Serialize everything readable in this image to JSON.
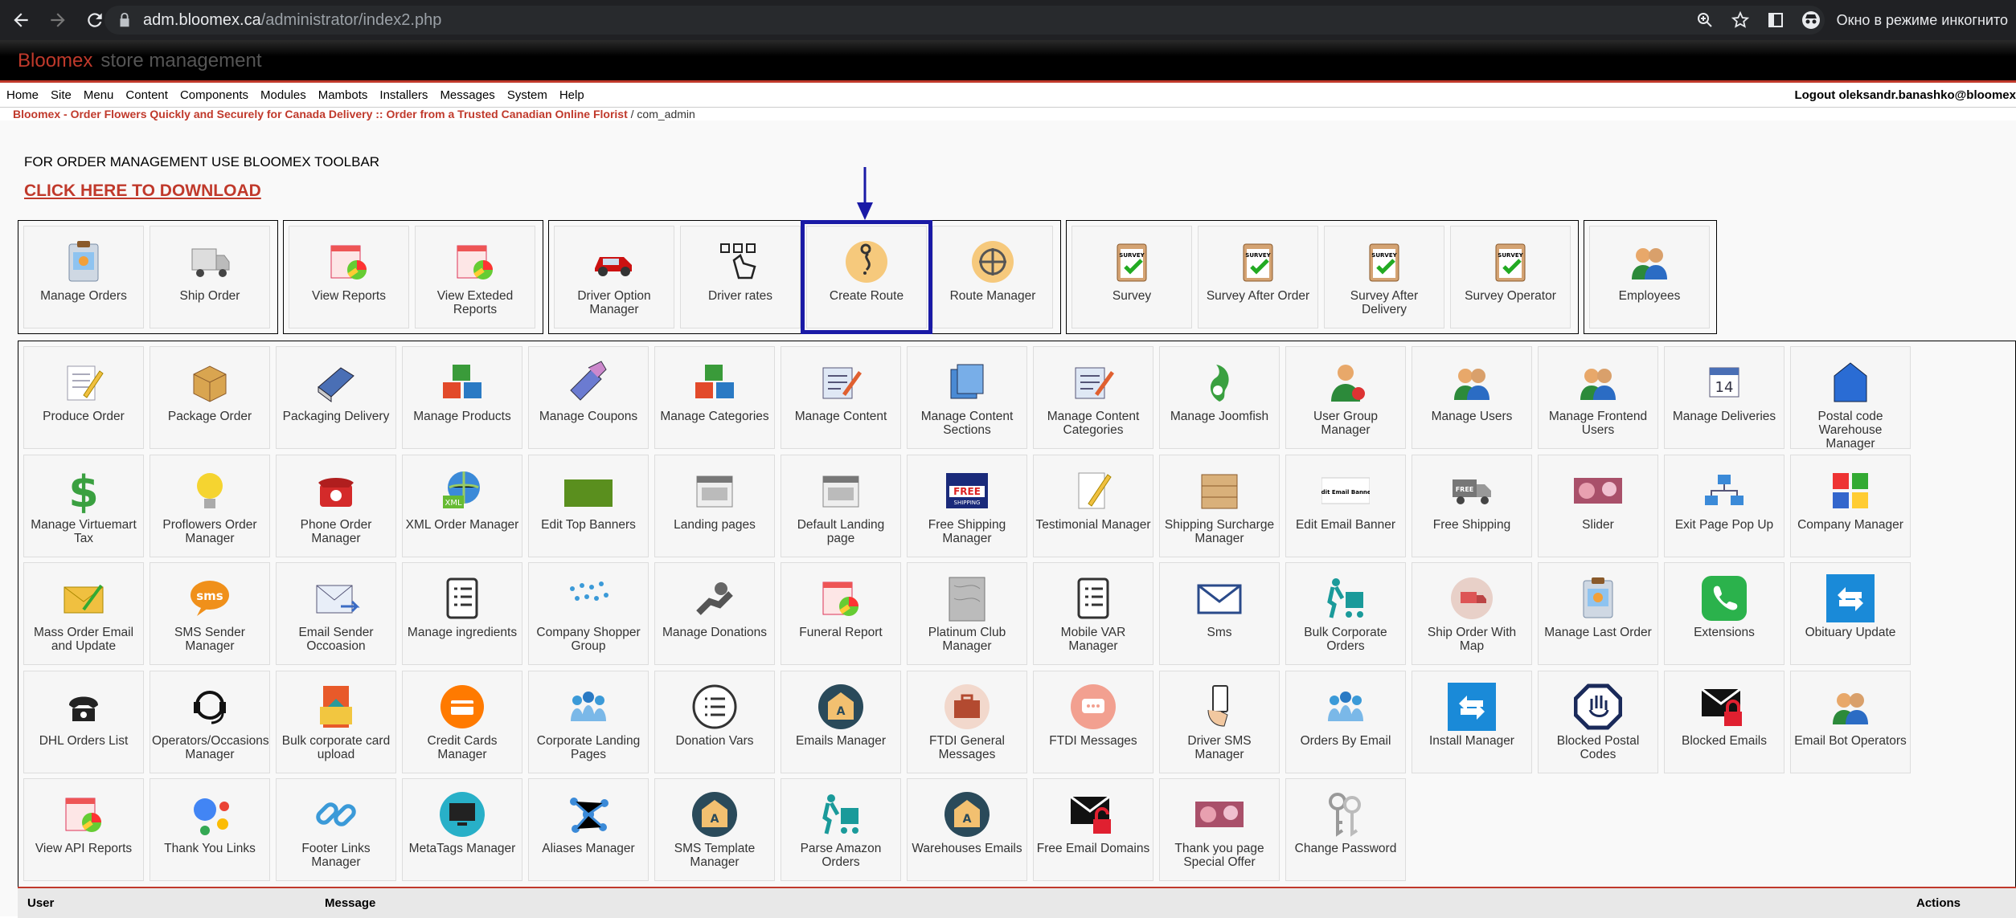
{
  "browser": {
    "url_host": "adm.bloomex.ca",
    "url_path": "/administrator/index2.php",
    "incognito_label": "Окно в режиме инкогнито"
  },
  "header": {
    "brand": "Bloomex",
    "subtitle": "store management"
  },
  "menu": {
    "items": [
      "Home",
      "Site",
      "Menu",
      "Content",
      "Components",
      "Modules",
      "Mambots",
      "Installers",
      "Messages",
      "System",
      "Help"
    ],
    "logout": "Logout oleksandr.banashko@bloomex"
  },
  "pathway": {
    "site": "Bloomex - Order Flowers Quickly and Securely for Canada Delivery :: Order from a Trusted Canadian Online Florist",
    "current": " / com_admin"
  },
  "main": {
    "toolbar_note": "FOR ORDER MANAGEMENT USE  BLOOMEX TOOLBAR",
    "download_link": "CLICK HERE TO DOWNLOAD"
  },
  "top_groups": [
    [
      "Manage Orders",
      "Ship Order"
    ],
    [
      "View Reports",
      "View Exteded Reports"
    ],
    [
      "Driver Option Manager",
      "Driver rates",
      "Create Route",
      "Route Manager"
    ],
    [
      "Survey",
      "Survey After Order",
      "Survey After Delivery",
      "Survey Operator"
    ],
    [
      "Employees"
    ]
  ],
  "grid_rows": [
    [
      "Produce Order",
      "Package Order",
      "Packaging Delivery",
      "Manage Products",
      "Manage Coupons",
      "Manage Categories",
      "Manage Content",
      "Manage Content Sections",
      "Manage Content Categories",
      "Manage Joomfish",
      "User Group Manager",
      "Manage Users",
      "Manage Frontend Users",
      "Manage Deliveries",
      "Postal code Warehouse Manager"
    ],
    [
      "Manage Virtuemart Tax",
      "Proflowers Order Manager",
      "Phone Order Manager",
      "XML Order Manager",
      "Edit Top Banners",
      "Landing pages",
      "Default Landing page",
      "Free Shipping Manager",
      "Testimonial Manager",
      "Shipping Surcharge Manager",
      "Edit Email Banner",
      "Free Shipping",
      "Slider",
      "Exit Page Pop Up",
      "Company Manager"
    ],
    [
      "Mass Order Email and Update",
      "SMS Sender Manager",
      "Email Sender Occoasion",
      "Manage ingredients",
      "Company Shopper Group",
      "Manage Donations",
      "Funeral Report",
      "Platinum Club Manager",
      "Mobile VAR Manager",
      "Sms",
      "Bulk Corporate Orders",
      "Ship Order With Map",
      "Manage Last Order",
      "Extensions",
      "Obituary Update"
    ],
    [
      "DHL Orders List",
      "Operators/Occasions Manager",
      "Bulk corporate card upload",
      "Credit Cards Manager",
      "Corporate Landing Pages",
      "Donation Vars",
      "Emails Manager",
      "FTDI General Messages",
      "FTDI Messages",
      "Driver SMS Manager",
      "Orders By Email",
      "Install Manager",
      "Blocked Postal Codes",
      "Blocked Emails",
      "Email Bot Operators"
    ],
    [
      "View API Reports",
      "Thank You Links",
      "Footer Links Manager",
      "MetaTags Manager",
      "Aliases Manager",
      "SMS Template Manager",
      "Parse Amazon Orders",
      "Warehouses Emails",
      "Free Email Domains",
      "Thank you page Special Offer",
      "Change Password"
    ]
  ],
  "table": {
    "col_user": "User",
    "col_message": "Message",
    "col_actions": "Actions"
  },
  "mini_labels": {
    "edit_email_banner_img": "Edit Email Banner",
    "survey_badge": "SURVEY",
    "free_badge": "FREE",
    "shipping_badge": "SHIPPING",
    "sms_badge": "sms",
    "xml_badge": "XML",
    "calendar_day": "14"
  },
  "colors": {
    "brand_red": "#c0392b",
    "highlight_blue": "#1a1aa6"
  }
}
